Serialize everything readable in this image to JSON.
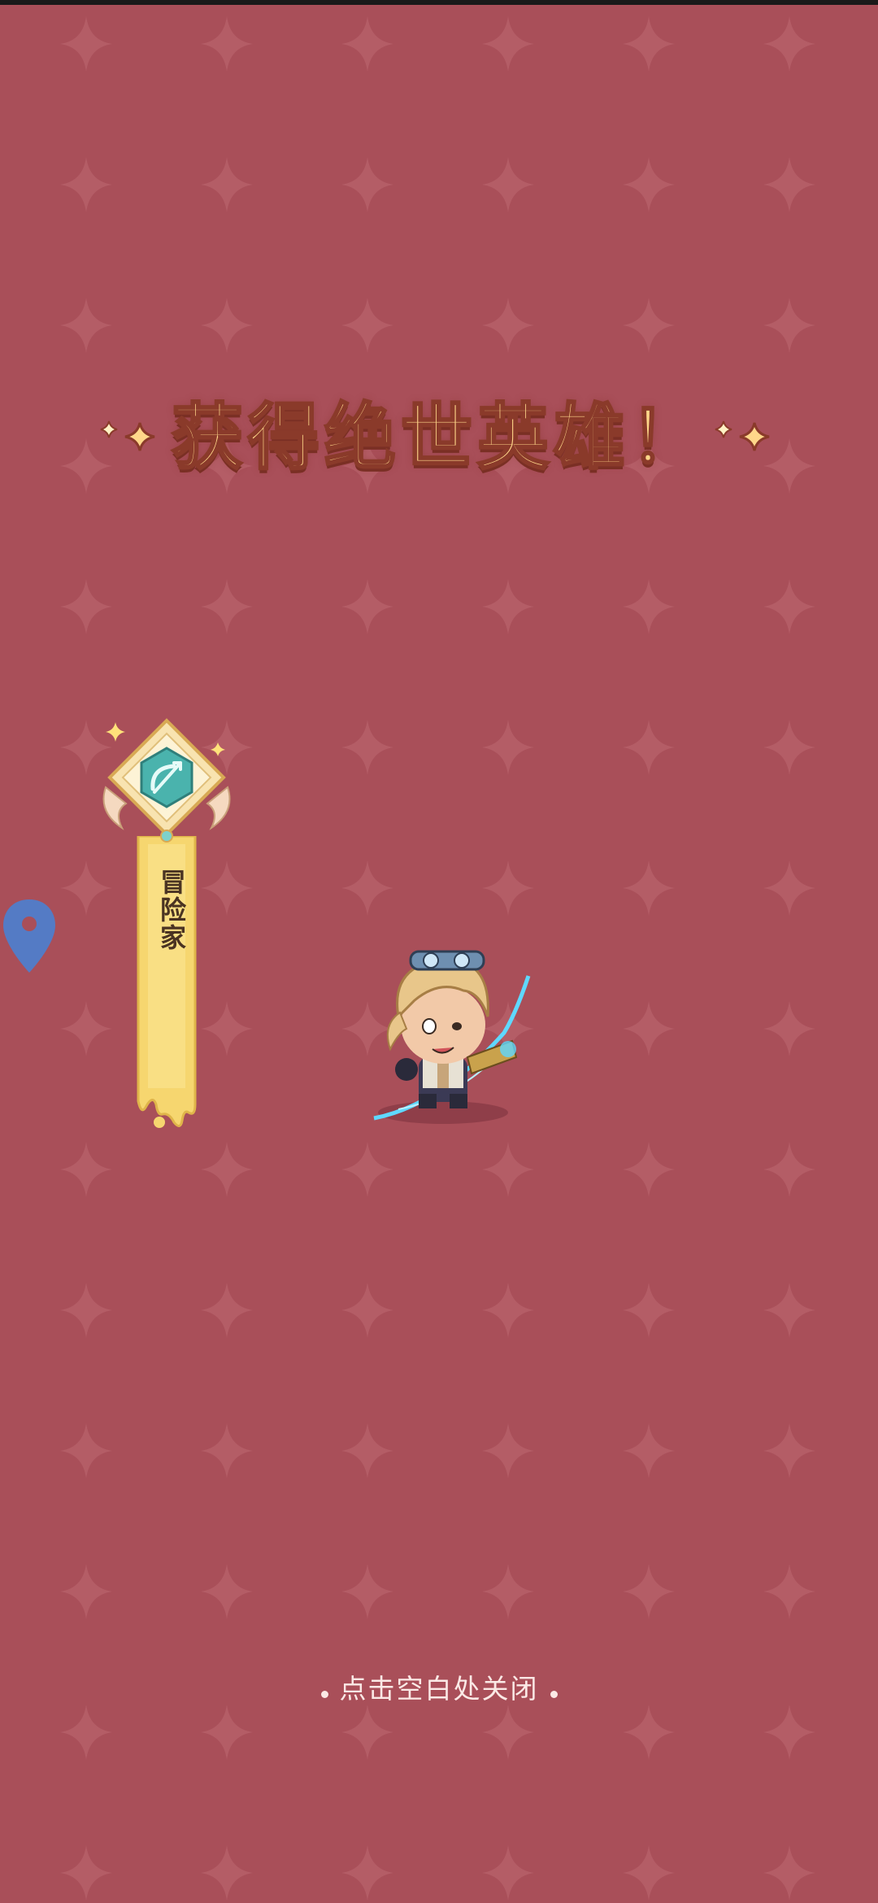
{
  "title": "获得绝世英雄！",
  "hero_class": {
    "label": "冒险家",
    "emblem_icon": "bow-arrow-icon"
  },
  "close_hint": "点击空白处关闭",
  "colors": {
    "background": "#a94f59",
    "pattern_star": "#b65f69",
    "title_fill": "#ffd78a",
    "title_stroke": "#8a3a2a",
    "banner_yellow": "#f6d66f",
    "emblem_teal": "#4ab3ad",
    "pin_blue": "#4a7fd0"
  }
}
